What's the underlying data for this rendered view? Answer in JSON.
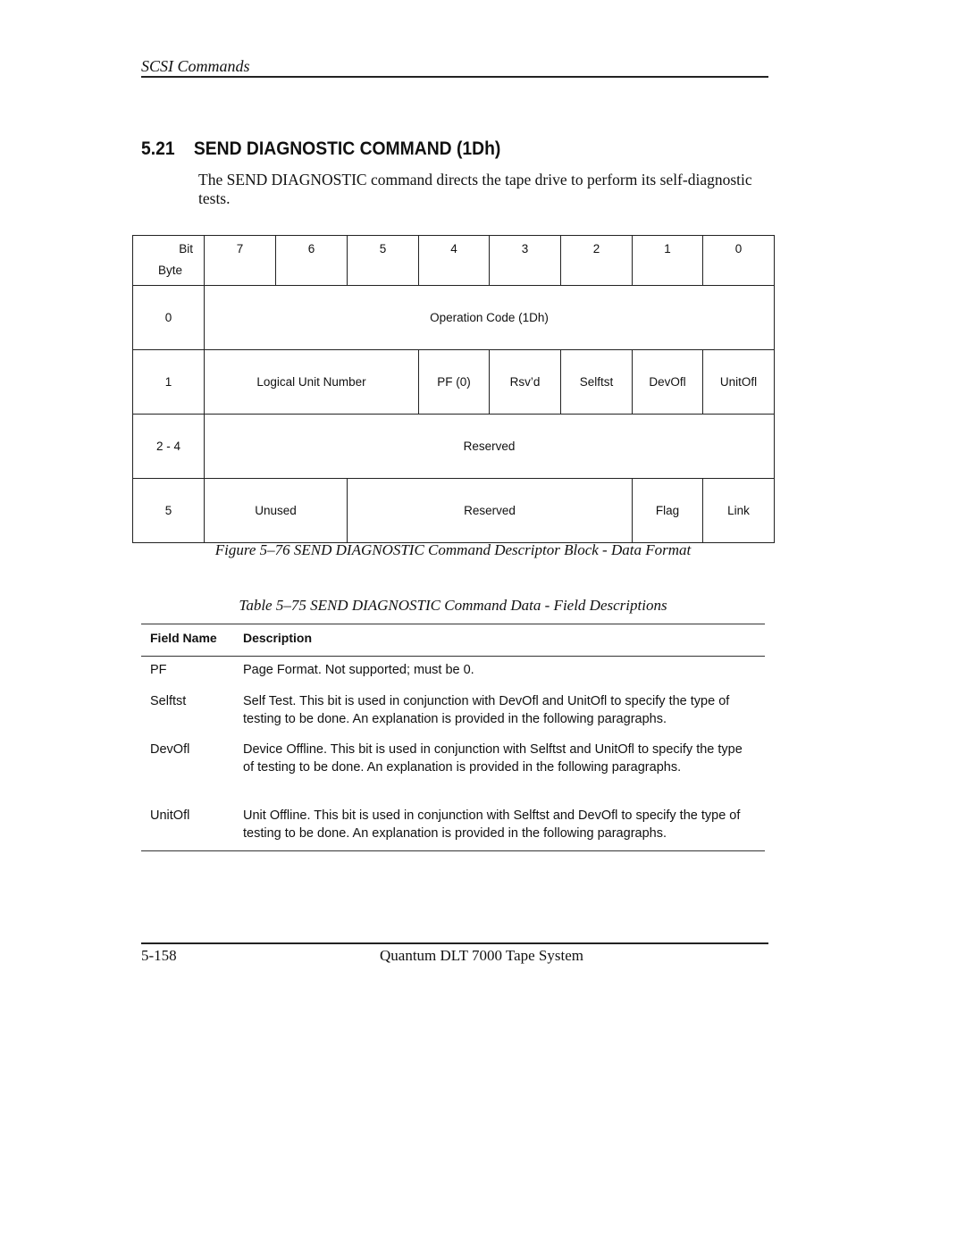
{
  "header": {
    "running_head": "SCSI Commands"
  },
  "section": {
    "number": "5.21",
    "title": "SEND DIAGNOSTIC COMMAND  (1Dh)",
    "intro": "The SEND DIAGNOSTIC command directs the tape drive to perform its self-diagnostic tests."
  },
  "cdb_table": {
    "bit_label": "Bit",
    "byte_label": "Byte",
    "bits": [
      "7",
      "6",
      "5",
      "4",
      "3",
      "2",
      "1",
      "0"
    ],
    "rows": [
      {
        "byte": "0",
        "cells": [
          {
            "text": "Operation Code (1Dh)",
            "span": 8
          }
        ]
      },
      {
        "byte": "1",
        "cells": [
          {
            "text": "Logical Unit Number",
            "span": 3
          },
          {
            "text": "PF (0)",
            "span": 1
          },
          {
            "text": "Rsv’d",
            "span": 1
          },
          {
            "text": "Selftst",
            "span": 1
          },
          {
            "text": "DevOfl",
            "span": 1
          },
          {
            "text": "UnitOfl",
            "span": 1
          }
        ]
      },
      {
        "byte": "2 - 4",
        "cells": [
          {
            "text": "Reserved",
            "span": 8
          }
        ]
      },
      {
        "byte": "5",
        "cells": [
          {
            "text": "Unused",
            "span": 2
          },
          {
            "text": "Reserved",
            "span": 4
          },
          {
            "text": "Flag",
            "span": 1
          },
          {
            "text": "Link",
            "span": 1
          }
        ]
      }
    ],
    "caption": "Figure 5–76  SEND DIAGNOSTIC Command Descriptor Block - Data Format"
  },
  "field_table": {
    "caption": "Table 5–75  SEND DIAGNOSTIC Command Data - Field Descriptions",
    "headers": {
      "name": "Field Name",
      "description": "Description"
    },
    "rows": [
      {
        "name": "PF",
        "description": "Page Format. Not supported; must be 0."
      },
      {
        "name": "Selftst",
        "description": "Self Test. This bit is used in conjunction with DevOfl and UnitOfl to specify the type of testing to be done. An explanation is provided in the following paragraphs."
      },
      {
        "name": "DevOfl",
        "description": "Device Offline. This bit is used in conjunction with Selftst and UnitOfl to specify the type of testing to be done. An explanation is provided in the following paragraphs."
      },
      {
        "name": "UnitOfl",
        "description": "Unit Offline. This bit is used in conjunction with Selftst and DevOfl to specify the type of testing to be done. An explanation is provided in the following paragraphs."
      }
    ]
  },
  "footer": {
    "page_number": "5-158",
    "title": "Quantum DLT 7000 Tape System"
  }
}
